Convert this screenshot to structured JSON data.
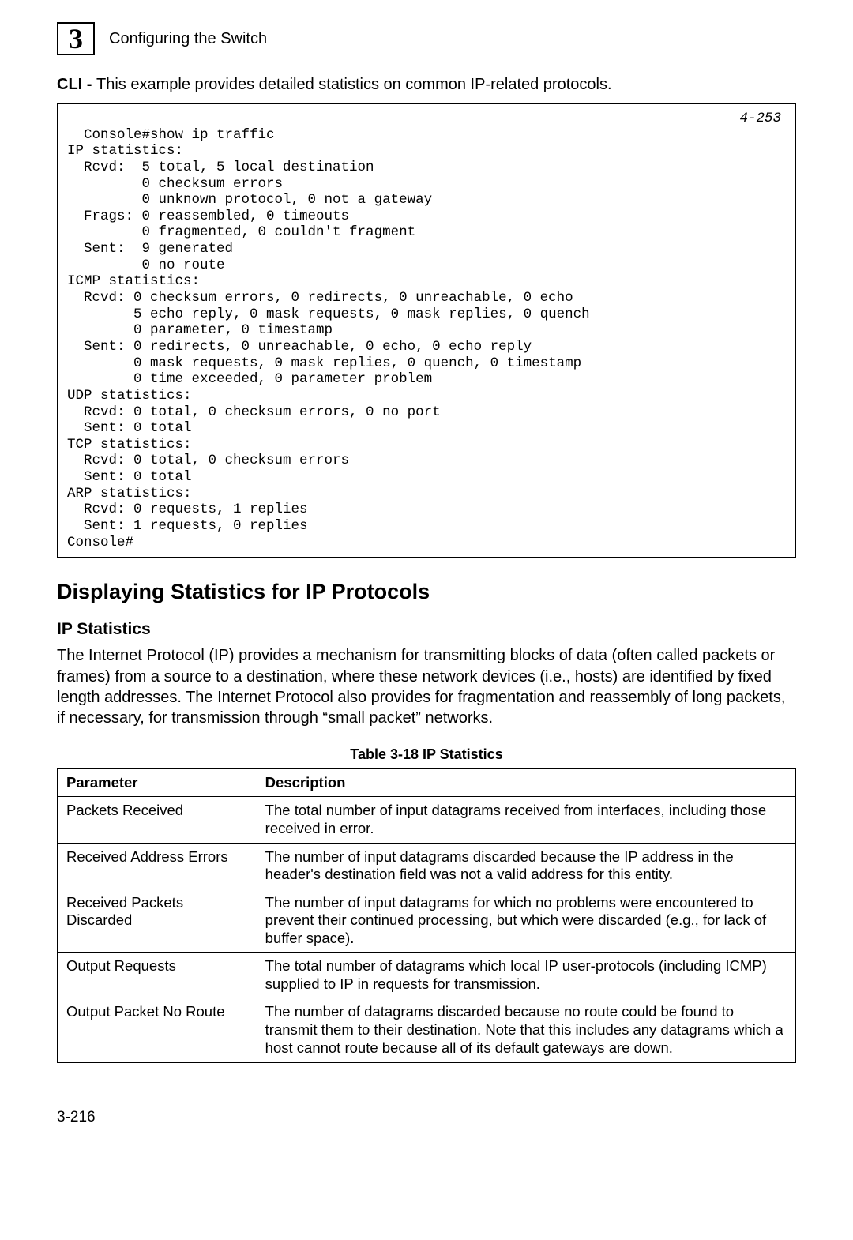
{
  "header": {
    "chapter_num": "3",
    "chapter_title": "Configuring the Switch"
  },
  "intro": {
    "label": "CLI - ",
    "text": "This example provides detailed statistics on common IP-related protocols."
  },
  "cli": {
    "ref": "4-253",
    "body": "Console#show ip traffic\nIP statistics:\n  Rcvd:  5 total, 5 local destination\n         0 checksum errors\n         0 unknown protocol, 0 not a gateway\n  Frags: 0 reassembled, 0 timeouts\n         0 fragmented, 0 couldn't fragment\n  Sent:  9 generated\n         0 no route\nICMP statistics:\n  Rcvd: 0 checksum errors, 0 redirects, 0 unreachable, 0 echo\n        5 echo reply, 0 mask requests, 0 mask replies, 0 quench\n        0 parameter, 0 timestamp\n  Sent: 0 redirects, 0 unreachable, 0 echo, 0 echo reply\n        0 mask requests, 0 mask replies, 0 quench, 0 timestamp\n        0 time exceeded, 0 parameter problem\nUDP statistics:\n  Rcvd: 0 total, 0 checksum errors, 0 no port\n  Sent: 0 total\nTCP statistics:\n  Rcvd: 0 total, 0 checksum errors\n  Sent: 0 total\nARP statistics:\n  Rcvd: 0 requests, 1 replies\n  Sent: 1 requests, 0 replies\nConsole#"
  },
  "section": {
    "heading": "Displaying Statistics for IP Protocols",
    "subheading": "IP Statistics",
    "paragraph": "The Internet Protocol (IP) provides a mechanism for transmitting blocks of data (often called packets or frames) from a source to a destination, where these network devices (i.e., hosts) are identified by fixed length addresses. The Internet Protocol also provides for fragmentation and reassembly of long packets, if necessary, for transmission through “small packet” networks."
  },
  "table": {
    "caption": "Table 3-18   IP Statistics",
    "headers": {
      "param": "Parameter",
      "desc": "Description"
    },
    "rows": [
      {
        "param": "Packets Received",
        "desc": "The total number of input datagrams received from interfaces, including those received in error."
      },
      {
        "param": "Received Address Errors",
        "desc": "The number of input datagrams discarded because the IP address in the header's destination field was not a valid address for this entity."
      },
      {
        "param": "Received Packets Discarded",
        "desc": "The number of input datagrams for which no problems were encountered to prevent their continued processing, but which were discarded (e.g., for lack of buffer space)."
      },
      {
        "param": "Output Requests",
        "desc": "The total number of datagrams which local IP user-protocols (including ICMP) supplied to IP in requests for transmission."
      },
      {
        "param": "Output Packet No Route",
        "desc": "The number of datagrams discarded because no route could be found to transmit them to their destination. Note that this includes any datagrams which a host cannot route because all of its default gateways are down."
      }
    ]
  },
  "footer": {
    "page": "3-216"
  }
}
